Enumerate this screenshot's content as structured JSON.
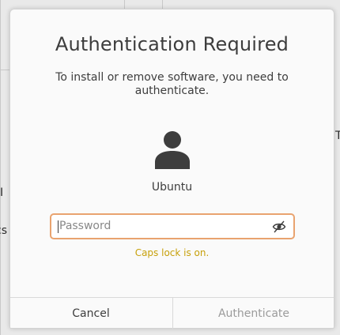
{
  "background": {
    "fragments": [
      "T",
      "I",
      "cs"
    ]
  },
  "dialog": {
    "title": "Authentication Required",
    "message": "To install or remove software, you need to authenticate.",
    "avatar_icon": "user-avatar-icon",
    "username": "Ubuntu",
    "password": {
      "placeholder": "Password",
      "value": "",
      "toggle_icon": "reveal-password-icon"
    },
    "warning": "Caps lock is on.",
    "cancel_label": "Cancel",
    "authenticate_label": "Authenticate"
  },
  "colors": {
    "field_border": "#e9a36f",
    "warning": "#c7a00a",
    "disabled_text": "#9b9b9b"
  }
}
